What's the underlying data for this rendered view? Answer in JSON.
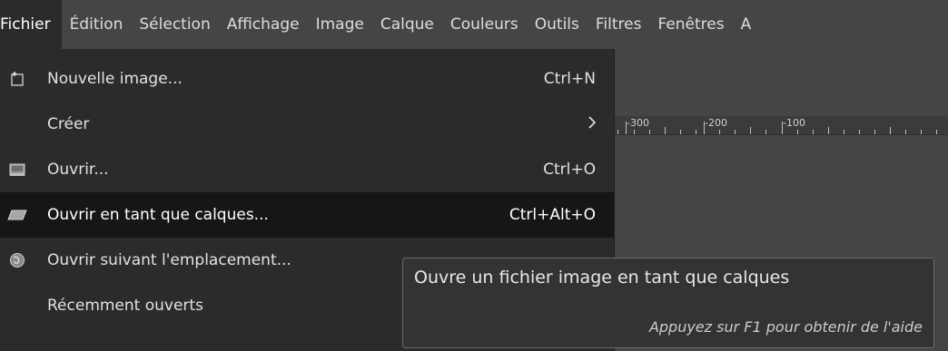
{
  "menubar": {
    "items": [
      {
        "label": "Fichier"
      },
      {
        "label": "Édition"
      },
      {
        "label": "Sélection"
      },
      {
        "label": "Affichage"
      },
      {
        "label": "Image"
      },
      {
        "label": "Calque"
      },
      {
        "label": "Couleurs"
      },
      {
        "label": "Outils"
      },
      {
        "label": "Filtres"
      },
      {
        "label": "Fenêtres"
      },
      {
        "label": "A"
      }
    ]
  },
  "file_menu": {
    "items": [
      {
        "icon": "new-image-icon",
        "label": "Nouvelle image...",
        "shortcut": "Ctrl+N"
      },
      {
        "icon": "",
        "label": "Créer",
        "submenu": ">"
      },
      {
        "icon": "open-icon",
        "label": "Ouvrir...",
        "shortcut": "Ctrl+O"
      },
      {
        "icon": "open-as-layers-icon",
        "label": "Ouvrir en tant que calques...",
        "shortcut": "Ctrl+Alt+O"
      },
      {
        "icon": "open-location-icon",
        "label": "Ouvrir suivant l'emplacement..."
      },
      {
        "icon": "",
        "label": "Récemment ouverts"
      }
    ]
  },
  "ruler": {
    "labels": [
      "-300",
      "-200",
      "-100"
    ]
  },
  "tooltip": {
    "title": "Ouvre un fichier image en tant que calques",
    "hint": "Appuyez sur F1 pour obtenir de l'aide"
  },
  "colors": {
    "background": "#454545",
    "menu_background": "#2b2b2b",
    "highlight": "#161616",
    "text": "#e2e2e2"
  }
}
